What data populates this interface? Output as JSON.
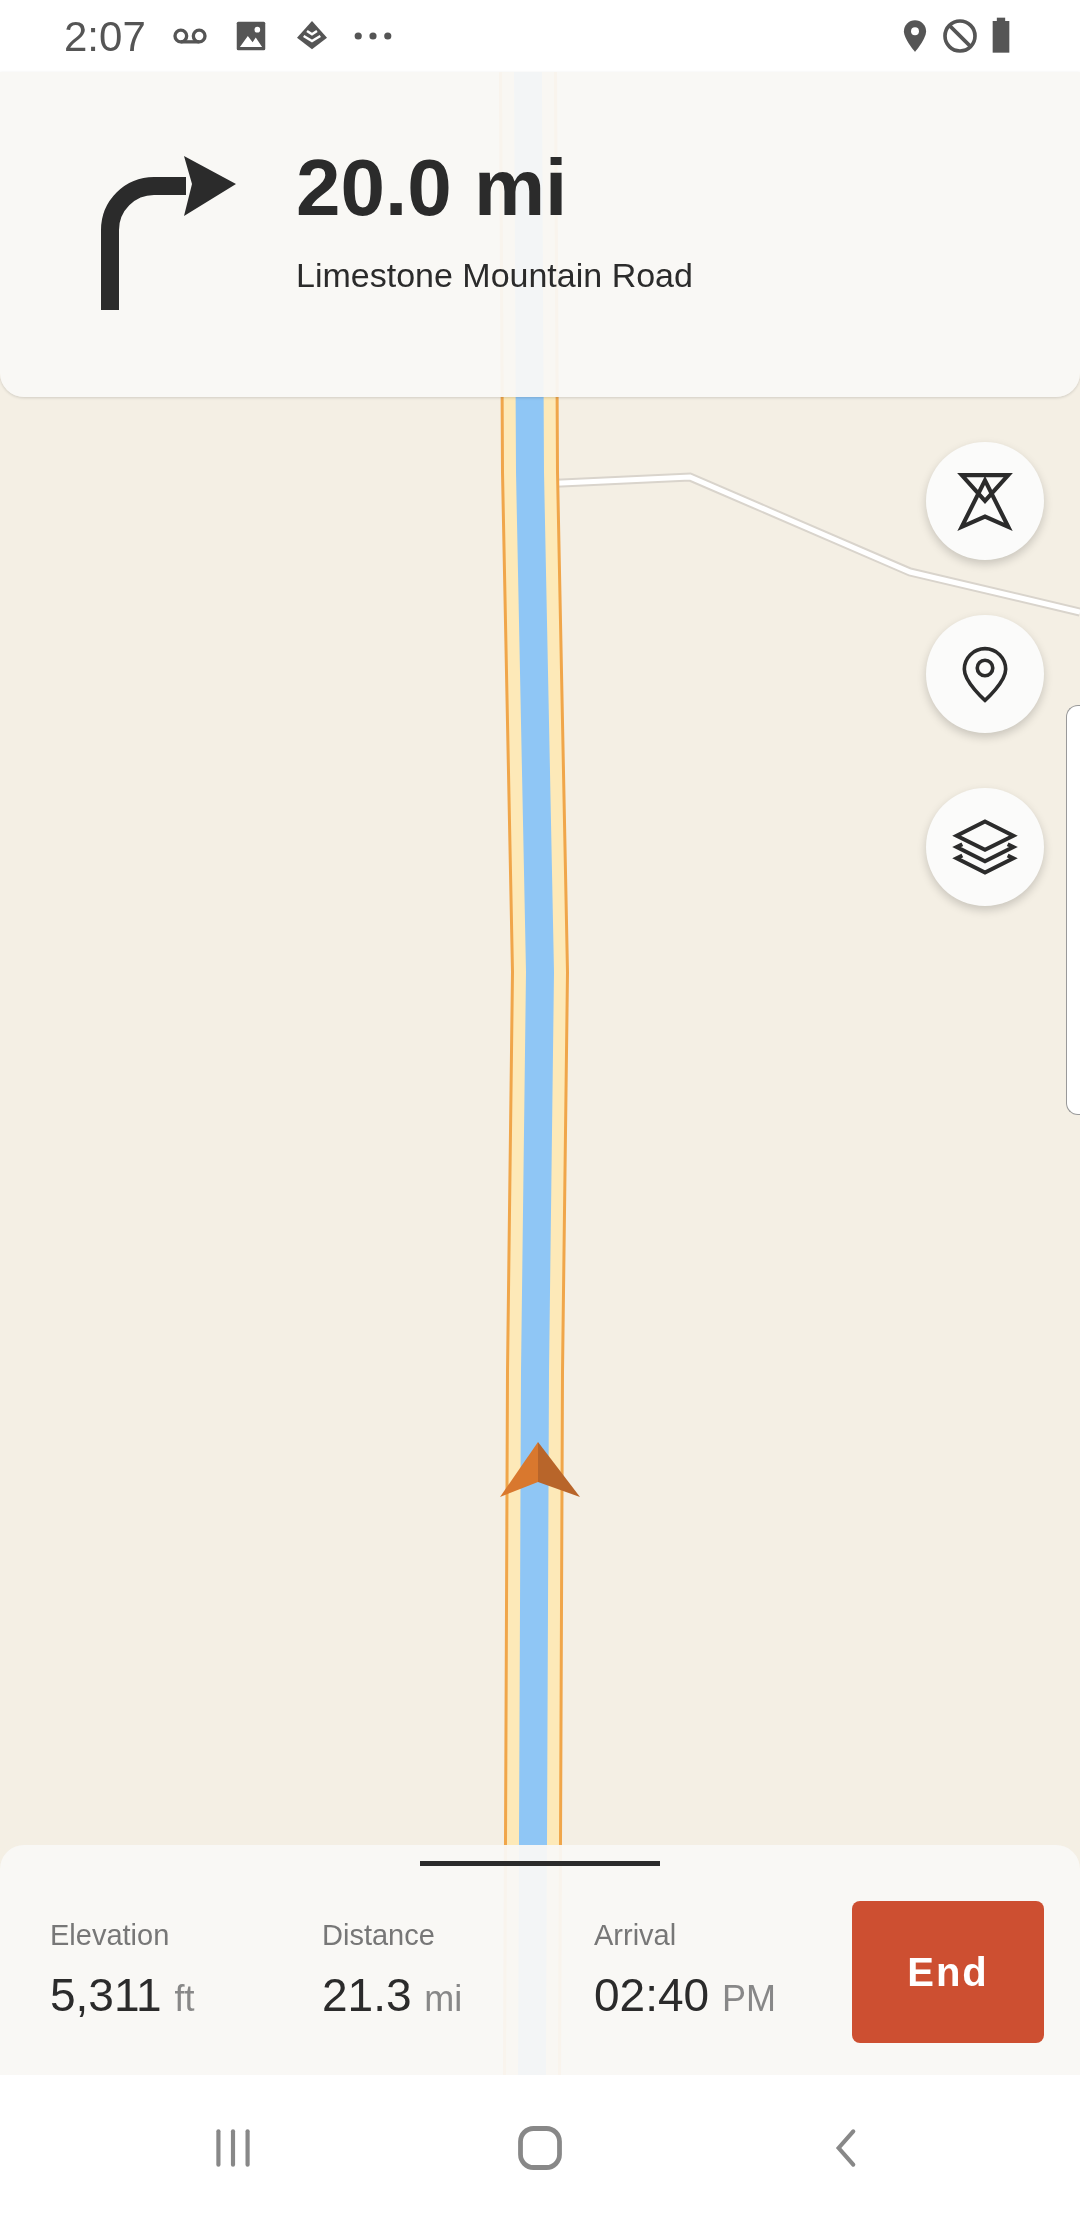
{
  "status_bar": {
    "time": "2:07"
  },
  "instruction": {
    "distance": "20.0 mi",
    "street": "Limestone Mountain Road"
  },
  "trip_stats": [
    {
      "label": "Elevation",
      "value": "5,311",
      "unit": "ft"
    },
    {
      "label": "Distance",
      "value": "21.3",
      "unit": "mi"
    },
    {
      "label": "Arrival",
      "value": "02:40",
      "unit": "PM"
    }
  ],
  "end_button": {
    "label": "End"
  }
}
